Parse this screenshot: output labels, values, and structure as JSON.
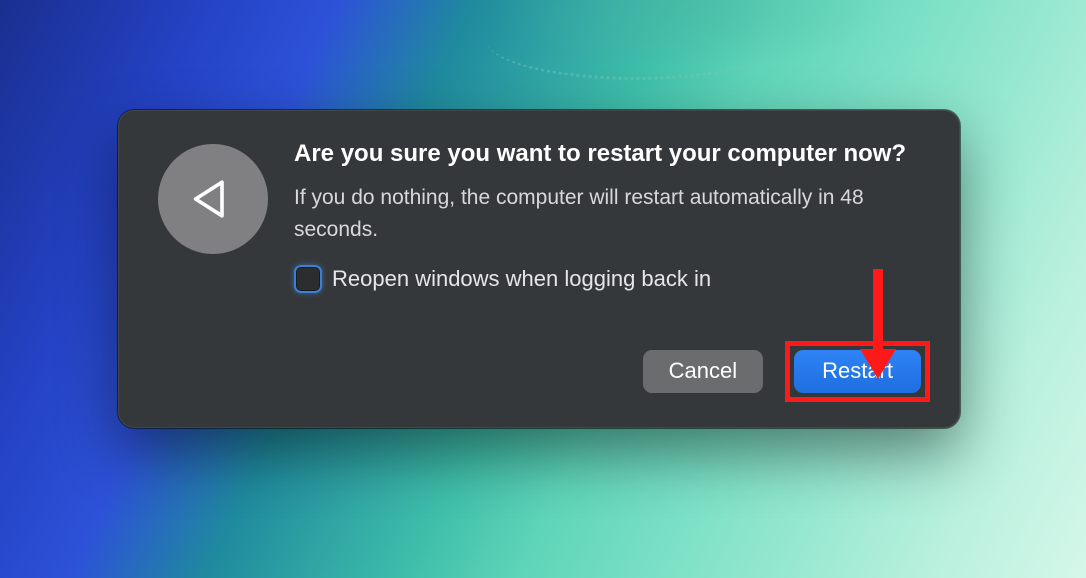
{
  "dialog": {
    "title": "Are you sure you want to restart your computer now?",
    "message": "If you do nothing, the computer will restart automatically in 48 seconds.",
    "checkbox_label": "Reopen windows when logging back in",
    "cancel_label": "Cancel",
    "restart_label": "Restart"
  },
  "icons": {
    "restart": "restart-back-icon"
  },
  "annotation": {
    "target": "restart-button",
    "color": "#ff1a1a"
  }
}
